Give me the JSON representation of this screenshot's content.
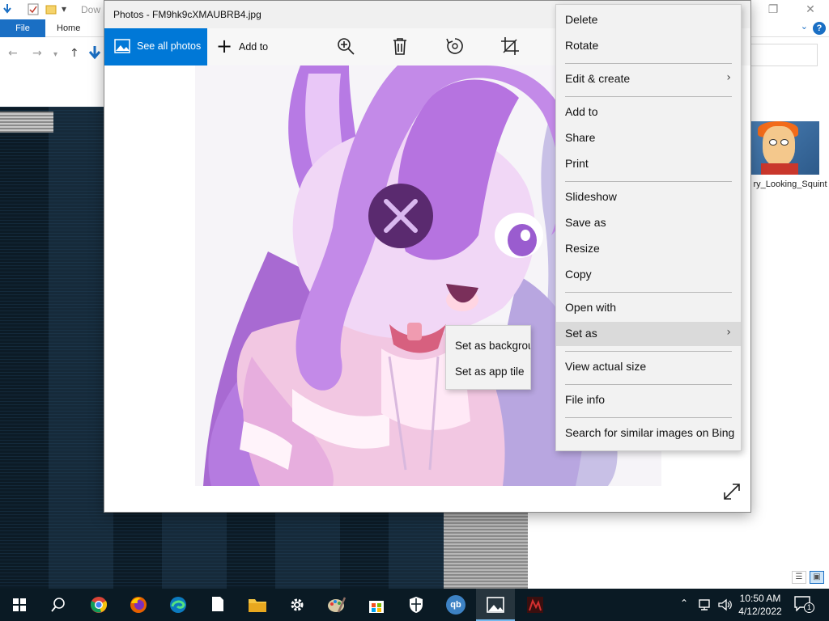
{
  "explorer": {
    "title_fragment": "Dow",
    "ribbon": {
      "file_tab": "File",
      "home_tab": "Home",
      "help": "?"
    },
    "file": {
      "name": "ry_Looking_Squint"
    }
  },
  "photos": {
    "title": "Photos - FM9hk9cXMAUBRB4.jpg",
    "toolbar": {
      "see_all_photos": "See all photos",
      "add_to": "Add to",
      "icons": [
        "zoom-in-icon",
        "delete-icon",
        "rotate-icon",
        "crop-icon"
      ]
    }
  },
  "context_menu": {
    "items": [
      {
        "label": "Delete"
      },
      {
        "label": "Rotate"
      },
      {
        "label": "Edit & create",
        "submenu": true
      },
      {
        "label": "Add to"
      },
      {
        "label": "Share"
      },
      {
        "label": "Print"
      },
      {
        "label": "Slideshow"
      },
      {
        "label": "Save as"
      },
      {
        "label": "Resize"
      },
      {
        "label": "Copy"
      },
      {
        "label": "Open with"
      },
      {
        "label": "Set as",
        "submenu": true,
        "highlighted": true
      },
      {
        "label": "View actual size"
      },
      {
        "label": "File info"
      },
      {
        "label": "Search for similar images on Bing"
      }
    ]
  },
  "submenu": {
    "items": [
      {
        "label": "Set as background"
      },
      {
        "label": "Set as app tile"
      }
    ]
  },
  "taskbar": {
    "apps": [
      "start-icon",
      "search-icon",
      "chrome-icon",
      "firefox-icon",
      "edge-icon",
      "notepad-icon",
      "file-explorer-icon",
      "settings-icon",
      "paint-icon",
      "store-icon",
      "security-icon",
      "qbittorrent-icon",
      "photos-icon",
      "game-icon"
    ],
    "qb_label": "qb",
    "time": "10:50 AM",
    "date": "4/12/2022",
    "notification_count": "1"
  },
  "colors": {
    "accent": "#0078d7",
    "taskbar": "#0a1a24",
    "menu_bg": "#f2f2f2",
    "menu_highlight": "#dadada"
  }
}
